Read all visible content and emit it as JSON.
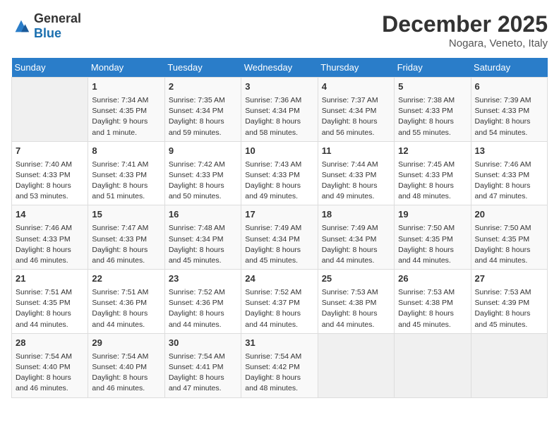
{
  "header": {
    "logo_general": "General",
    "logo_blue": "Blue",
    "month_title": "December 2025",
    "location": "Nogara, Veneto, Italy"
  },
  "days_of_week": [
    "Sunday",
    "Monday",
    "Tuesday",
    "Wednesday",
    "Thursday",
    "Friday",
    "Saturday"
  ],
  "weeks": [
    [
      {
        "day": "",
        "empty": true
      },
      {
        "day": "1",
        "sunrise": "Sunrise: 7:34 AM",
        "sunset": "Sunset: 4:35 PM",
        "daylight": "Daylight: 9 hours and 1 minute."
      },
      {
        "day": "2",
        "sunrise": "Sunrise: 7:35 AM",
        "sunset": "Sunset: 4:34 PM",
        "daylight": "Daylight: 8 hours and 59 minutes."
      },
      {
        "day": "3",
        "sunrise": "Sunrise: 7:36 AM",
        "sunset": "Sunset: 4:34 PM",
        "daylight": "Daylight: 8 hours and 58 minutes."
      },
      {
        "day": "4",
        "sunrise": "Sunrise: 7:37 AM",
        "sunset": "Sunset: 4:34 PM",
        "daylight": "Daylight: 8 hours and 56 minutes."
      },
      {
        "day": "5",
        "sunrise": "Sunrise: 7:38 AM",
        "sunset": "Sunset: 4:33 PM",
        "daylight": "Daylight: 8 hours and 55 minutes."
      },
      {
        "day": "6",
        "sunrise": "Sunrise: 7:39 AM",
        "sunset": "Sunset: 4:33 PM",
        "daylight": "Daylight: 8 hours and 54 minutes."
      }
    ],
    [
      {
        "day": "7",
        "sunrise": "Sunrise: 7:40 AM",
        "sunset": "Sunset: 4:33 PM",
        "daylight": "Daylight: 8 hours and 53 minutes."
      },
      {
        "day": "8",
        "sunrise": "Sunrise: 7:41 AM",
        "sunset": "Sunset: 4:33 PM",
        "daylight": "Daylight: 8 hours and 51 minutes."
      },
      {
        "day": "9",
        "sunrise": "Sunrise: 7:42 AM",
        "sunset": "Sunset: 4:33 PM",
        "daylight": "Daylight: 8 hours and 50 minutes."
      },
      {
        "day": "10",
        "sunrise": "Sunrise: 7:43 AM",
        "sunset": "Sunset: 4:33 PM",
        "daylight": "Daylight: 8 hours and 49 minutes."
      },
      {
        "day": "11",
        "sunrise": "Sunrise: 7:44 AM",
        "sunset": "Sunset: 4:33 PM",
        "daylight": "Daylight: 8 hours and 49 minutes."
      },
      {
        "day": "12",
        "sunrise": "Sunrise: 7:45 AM",
        "sunset": "Sunset: 4:33 PM",
        "daylight": "Daylight: 8 hours and 48 minutes."
      },
      {
        "day": "13",
        "sunrise": "Sunrise: 7:46 AM",
        "sunset": "Sunset: 4:33 PM",
        "daylight": "Daylight: 8 hours and 47 minutes."
      }
    ],
    [
      {
        "day": "14",
        "sunrise": "Sunrise: 7:46 AM",
        "sunset": "Sunset: 4:33 PM",
        "daylight": "Daylight: 8 hours and 46 minutes."
      },
      {
        "day": "15",
        "sunrise": "Sunrise: 7:47 AM",
        "sunset": "Sunset: 4:33 PM",
        "daylight": "Daylight: 8 hours and 46 minutes."
      },
      {
        "day": "16",
        "sunrise": "Sunrise: 7:48 AM",
        "sunset": "Sunset: 4:34 PM",
        "daylight": "Daylight: 8 hours and 45 minutes."
      },
      {
        "day": "17",
        "sunrise": "Sunrise: 7:49 AM",
        "sunset": "Sunset: 4:34 PM",
        "daylight": "Daylight: 8 hours and 45 minutes."
      },
      {
        "day": "18",
        "sunrise": "Sunrise: 7:49 AM",
        "sunset": "Sunset: 4:34 PM",
        "daylight": "Daylight: 8 hours and 44 minutes."
      },
      {
        "day": "19",
        "sunrise": "Sunrise: 7:50 AM",
        "sunset": "Sunset: 4:35 PM",
        "daylight": "Daylight: 8 hours and 44 minutes."
      },
      {
        "day": "20",
        "sunrise": "Sunrise: 7:50 AM",
        "sunset": "Sunset: 4:35 PM",
        "daylight": "Daylight: 8 hours and 44 minutes."
      }
    ],
    [
      {
        "day": "21",
        "sunrise": "Sunrise: 7:51 AM",
        "sunset": "Sunset: 4:35 PM",
        "daylight": "Daylight: 8 hours and 44 minutes."
      },
      {
        "day": "22",
        "sunrise": "Sunrise: 7:51 AM",
        "sunset": "Sunset: 4:36 PM",
        "daylight": "Daylight: 8 hours and 44 minutes."
      },
      {
        "day": "23",
        "sunrise": "Sunrise: 7:52 AM",
        "sunset": "Sunset: 4:36 PM",
        "daylight": "Daylight: 8 hours and 44 minutes."
      },
      {
        "day": "24",
        "sunrise": "Sunrise: 7:52 AM",
        "sunset": "Sunset: 4:37 PM",
        "daylight": "Daylight: 8 hours and 44 minutes."
      },
      {
        "day": "25",
        "sunrise": "Sunrise: 7:53 AM",
        "sunset": "Sunset: 4:38 PM",
        "daylight": "Daylight: 8 hours and 44 minutes."
      },
      {
        "day": "26",
        "sunrise": "Sunrise: 7:53 AM",
        "sunset": "Sunset: 4:38 PM",
        "daylight": "Daylight: 8 hours and 45 minutes."
      },
      {
        "day": "27",
        "sunrise": "Sunrise: 7:53 AM",
        "sunset": "Sunset: 4:39 PM",
        "daylight": "Daylight: 8 hours and 45 minutes."
      }
    ],
    [
      {
        "day": "28",
        "sunrise": "Sunrise: 7:54 AM",
        "sunset": "Sunset: 4:40 PM",
        "daylight": "Daylight: 8 hours and 46 minutes."
      },
      {
        "day": "29",
        "sunrise": "Sunrise: 7:54 AM",
        "sunset": "Sunset: 4:40 PM",
        "daylight": "Daylight: 8 hours and 46 minutes."
      },
      {
        "day": "30",
        "sunrise": "Sunrise: 7:54 AM",
        "sunset": "Sunset: 4:41 PM",
        "daylight": "Daylight: 8 hours and 47 minutes."
      },
      {
        "day": "31",
        "sunrise": "Sunrise: 7:54 AM",
        "sunset": "Sunset: 4:42 PM",
        "daylight": "Daylight: 8 hours and 48 minutes."
      },
      {
        "day": "",
        "empty": true
      },
      {
        "day": "",
        "empty": true
      },
      {
        "day": "",
        "empty": true
      }
    ]
  ]
}
